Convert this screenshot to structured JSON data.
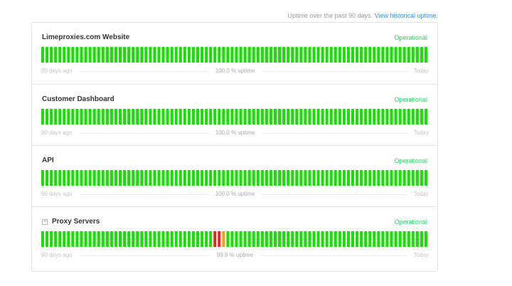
{
  "header": {
    "note": "Uptime over the past 90 days.",
    "link_label": "View historical uptime."
  },
  "colors": {
    "operational": "#2fcc66",
    "bar_up": "#16e000",
    "bar_major": "#e4241d",
    "bar_minor": "#f0a01e"
  },
  "components": [
    {
      "name": "Limeproxies.com Website",
      "status": "Operational",
      "expandable": false,
      "days_left": "90 days ago",
      "uptime": "100.0 % uptime",
      "days_right": "Today",
      "incident_days": []
    },
    {
      "name": "Customer Dashboard",
      "status": "Operational",
      "expandable": false,
      "days_left": "90 days ago",
      "uptime": "100.0 % uptime",
      "days_right": "Today",
      "incident_days": []
    },
    {
      "name": "API",
      "status": "Operational",
      "expandable": false,
      "days_left": "90 days ago",
      "uptime": "100.0 % uptime",
      "days_right": "Today",
      "incident_days": []
    },
    {
      "name": "Proxy Servers",
      "status": "Operational",
      "expandable": true,
      "days_left": "90 days ago",
      "uptime": "99.9 % uptime",
      "days_right": "Today",
      "incident_days": [
        {
          "day": 40,
          "level": "major"
        },
        {
          "day": 41,
          "level": "major"
        },
        {
          "day": 42,
          "level": "minor"
        }
      ]
    }
  ],
  "bar_count": 90
}
